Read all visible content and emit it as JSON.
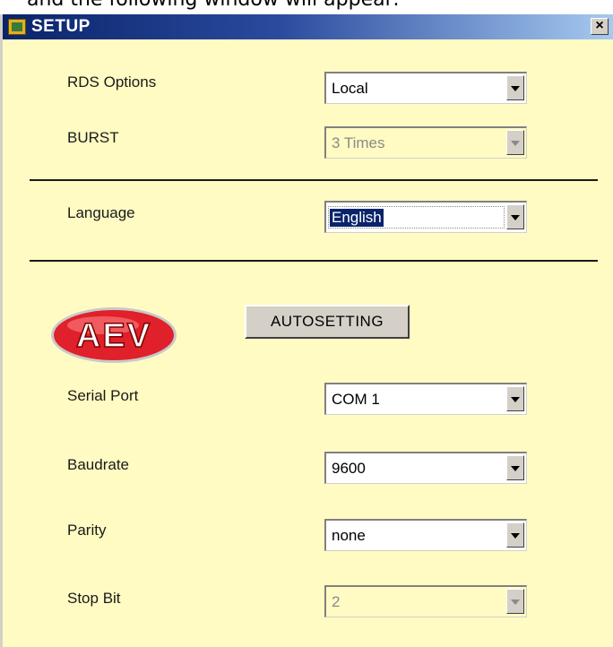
{
  "caption": "and the following window will appear:",
  "window": {
    "title": "SETUP",
    "close_glyph": "×"
  },
  "logo": {
    "text": "AEV"
  },
  "autosetting_button": "AUTOSETTING",
  "fields": {
    "rds_options": {
      "label": "RDS Options",
      "value": "Local",
      "enabled": true
    },
    "burst": {
      "label": "BURST",
      "value": "3 Times",
      "enabled": false
    },
    "language": {
      "label": "Language",
      "value": "English",
      "enabled": true,
      "focused": true
    },
    "serial_port": {
      "label": "Serial Port",
      "value": "COM 1",
      "enabled": true
    },
    "baudrate": {
      "label": "Baudrate",
      "value": "9600",
      "enabled": true
    },
    "parity": {
      "label": "Parity",
      "value": "none",
      "enabled": true
    },
    "stop_bit": {
      "label": "Stop Bit",
      "value": "2",
      "enabled": false
    }
  },
  "colors": {
    "window_background": "#fffbc3",
    "titlebar_start": "#0a246a",
    "titlebar_end": "#a6caf0",
    "logo_red": "#e0202a",
    "selection": "#0a246a"
  },
  "icons": {
    "window_icon": "setup-app-icon",
    "dropdown_arrow": "chevron-down-icon",
    "close": "close-icon"
  }
}
